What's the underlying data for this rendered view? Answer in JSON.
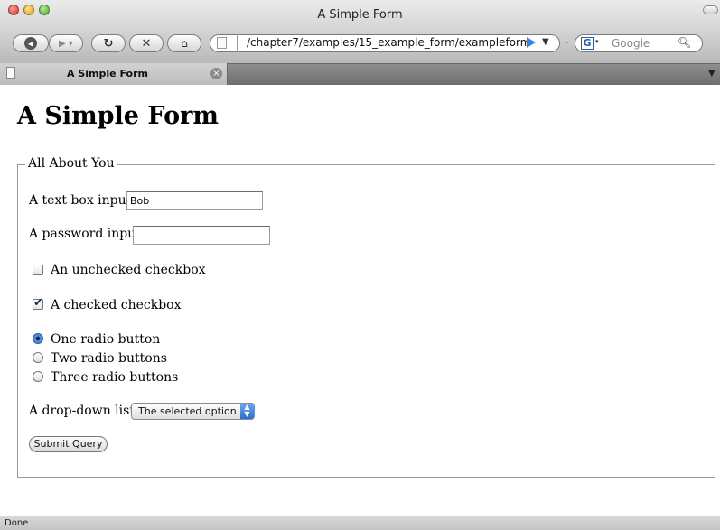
{
  "window": {
    "title": "A Simple Form"
  },
  "toolbar": {
    "url": "/chapter7/examples/15_example_form/exampleform",
    "search_placeholder": "Google",
    "url_dropdown": "▼"
  },
  "tab": {
    "title": "A Simple Form"
  },
  "page": {
    "heading": "A Simple Form",
    "legend": "All About You",
    "text_label": "A text box input:",
    "text_value": "Bob",
    "password_label": "A password input:",
    "password_value": "",
    "unchecked_label": "An unchecked checkbox",
    "checked_label": "A checked checkbox",
    "radios": [
      "One radio button",
      "Two radio buttons",
      "Three radio buttons"
    ],
    "dropdown_label": "A drop-down list:",
    "dropdown_selected": "The selected option",
    "submit_label": "Submit Query"
  },
  "status": {
    "text": "Done"
  },
  "colors": {
    "accent": "#2c6bc4",
    "chrome": "#d2d2d2"
  }
}
